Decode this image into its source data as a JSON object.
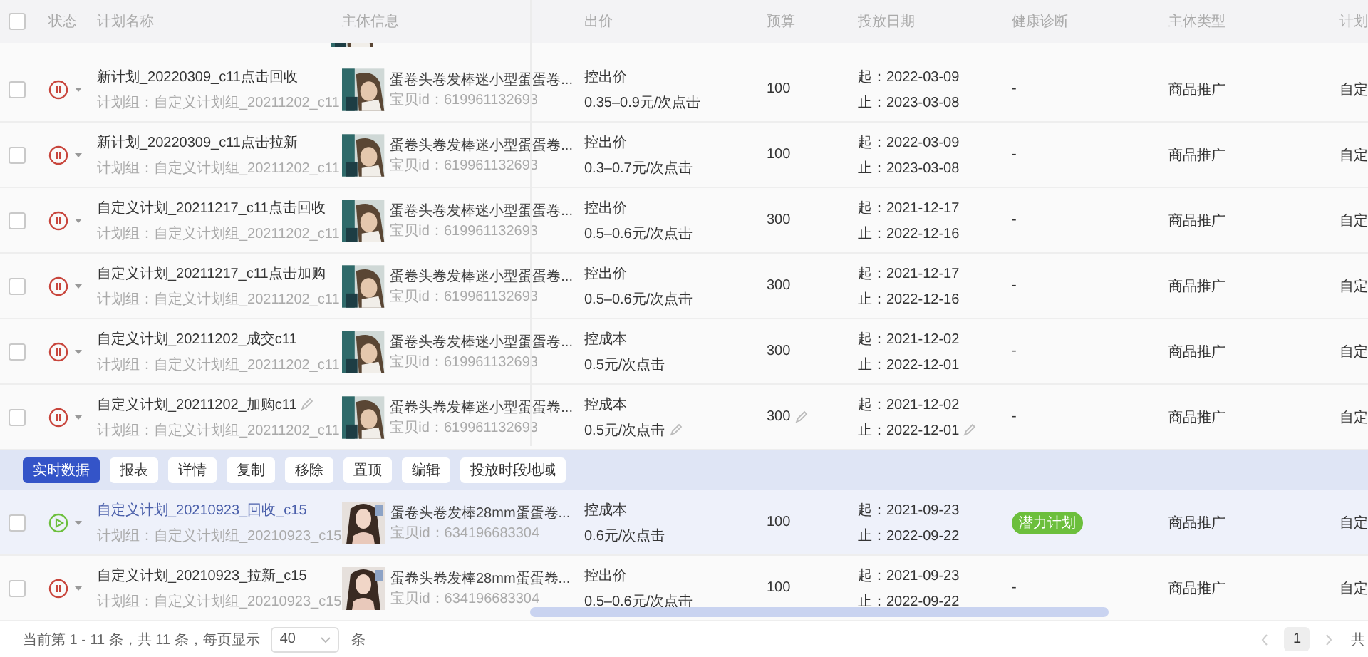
{
  "table": {
    "header_checkbox": {
      "checked": false
    },
    "columns": [
      "状态",
      "计划名称",
      "主体信息",
      "出价",
      "预算",
      "投放日期",
      "健康诊断",
      "主体类型",
      "计划"
    ],
    "rows": [
      {
        "running": false,
        "checked": false,
        "hovered": false,
        "editable": false,
        "name": "新计划_20220309_c11点击回收",
        "group": "计划组：自定义计划组_20211202_c11",
        "title": "蛋卷头卷发棒迷小型蛋蛋卷...",
        "item_id": "宝贝id：619961132693",
        "bid_type": "控出价",
        "bid": "0.35–0.9元/次点击",
        "budget": "100",
        "start": "起：2022-03-09",
        "end": "止：2023-03-08",
        "health": {
          "kind": "none",
          "text": "-"
        },
        "subject_type": "商品推广",
        "plan_group": "自定"
      },
      {
        "running": false,
        "checked": false,
        "hovered": false,
        "editable": false,
        "name": "新计划_20220309_c11点击拉新",
        "group": "计划组：自定义计划组_20211202_c11",
        "title": "蛋卷头卷发棒迷小型蛋蛋卷...",
        "item_id": "宝贝id：619961132693",
        "bid_type": "控出价",
        "bid": "0.3–0.7元/次点击",
        "budget": "100",
        "start": "起：2022-03-09",
        "end": "止：2023-03-08",
        "health": {
          "kind": "none",
          "text": "-"
        },
        "subject_type": "商品推广",
        "plan_group": "自定"
      },
      {
        "running": false,
        "checked": false,
        "hovered": false,
        "editable": false,
        "name": "自定义计划_20211217_c11点击回收",
        "group": "计划组：自定义计划组_20211202_c11",
        "title": "蛋卷头卷发棒迷小型蛋蛋卷...",
        "item_id": "宝贝id：619961132693",
        "bid_type": "控出价",
        "bid": "0.5–0.6元/次点击",
        "budget": "300",
        "start": "起：2021-12-17",
        "end": "止：2022-12-16",
        "health": {
          "kind": "none",
          "text": "-"
        },
        "subject_type": "商品推广",
        "plan_group": "自定"
      },
      {
        "running": false,
        "checked": false,
        "hovered": false,
        "editable": false,
        "name": "自定义计划_20211217_c11点击加购",
        "group": "计划组：自定义计划组_20211202_c11",
        "title": "蛋卷头卷发棒迷小型蛋蛋卷...",
        "item_id": "宝贝id：619961132693",
        "bid_type": "控出价",
        "bid": "0.5–0.6元/次点击",
        "budget": "300",
        "start": "起：2021-12-17",
        "end": "止：2022-12-16",
        "health": {
          "kind": "none",
          "text": "-"
        },
        "subject_type": "商品推广",
        "plan_group": "自定"
      },
      {
        "running": false,
        "checked": false,
        "hovered": false,
        "editable": false,
        "name": "自定义计划_20211202_成交c11",
        "group": "计划组：自定义计划组_20211202_c11",
        "title": "蛋卷头卷发棒迷小型蛋蛋卷...",
        "item_id": "宝贝id：619961132693",
        "bid_type": "控成本",
        "bid": "0.5元/次点击",
        "budget": "300",
        "start": "起：2021-12-02",
        "end": "止：2022-12-01",
        "health": {
          "kind": "none",
          "text": "-"
        },
        "subject_type": "商品推广",
        "plan_group": "自定"
      },
      {
        "running": false,
        "checked": false,
        "hovered": false,
        "editable": true,
        "name": "自定义计划_20211202_加购c11",
        "group": "计划组：自定义计划组_20211202_c11",
        "title": "蛋卷头卷发棒迷小型蛋蛋卷...",
        "item_id": "宝贝id：619961132693",
        "bid_type": "控成本",
        "bid": "0.5元/次点击",
        "budget": "300",
        "start": "起：2021-12-02",
        "end": "止：2022-12-01",
        "health": {
          "kind": "none",
          "text": "-"
        },
        "subject_type": "商品推广",
        "plan_group": "自定"
      }
    ],
    "actions": [
      {
        "label": "实时数据",
        "kind": "primary"
      },
      {
        "label": "报表",
        "kind": "default"
      },
      {
        "label": "详情",
        "kind": "default"
      },
      {
        "label": "复制",
        "kind": "default"
      },
      {
        "label": "移除",
        "kind": "default"
      },
      {
        "label": "置顶",
        "kind": "default"
      },
      {
        "label": "编辑",
        "kind": "default"
      },
      {
        "label": "投放时段地域",
        "kind": "default"
      }
    ],
    "rows_after": [
      {
        "running": true,
        "checked": false,
        "hovered": true,
        "editable": false,
        "name": "自定义计划_20210923_回收_c15",
        "group": "计划组：自定义计划组_20210923_c15",
        "title": "蛋卷头卷发棒28mm蛋蛋卷...",
        "item_id": "宝贝id：634196683304",
        "bid_type": "控成本",
        "bid": "0.6元/次点击",
        "budget": "100",
        "start": "起：2021-09-23",
        "end": "止：2022-09-22",
        "health": {
          "kind": "tag",
          "text": "潜力计划"
        },
        "subject_type": "商品推广",
        "plan_group": "自定"
      },
      {
        "running": false,
        "checked": false,
        "hovered": false,
        "editable": false,
        "name": "自定义计划_20210923_拉新_c15",
        "group": "计划组：自定义计划组_20210923_c15",
        "title": "蛋卷头卷发棒28mm蛋蛋卷...",
        "item_id": "宝贝id：634196683304",
        "bid_type": "控出价",
        "bid": "0.5–0.6元/次点击",
        "budget": "100",
        "start": "起：2021-09-23",
        "end": "止：2022-09-22",
        "health": {
          "kind": "none",
          "text": "-"
        },
        "subject_type": "商品推广",
        "plan_group": "自定"
      }
    ]
  },
  "footer": {
    "summary": "当前第 1 - 11 条，共 11 条，每页显示",
    "page_size": "40",
    "unit": "条",
    "pages": [
      {
        "label": "1",
        "selected": true
      }
    ],
    "total": "共"
  }
}
